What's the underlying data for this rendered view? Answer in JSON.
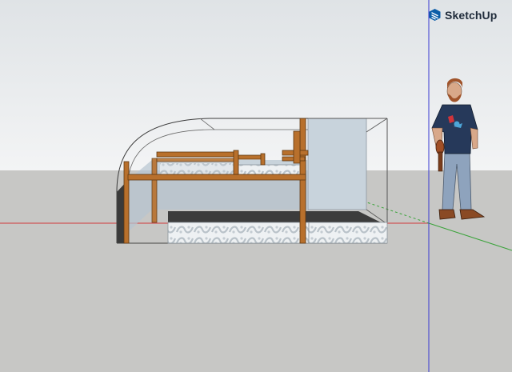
{
  "app": {
    "name": "SketchUp",
    "logo_icon": "sketchup-logo-icon"
  },
  "colors": {
    "sky_top": "#dfe3e6",
    "sky_bottom": "#f3f4f5",
    "ground": "#c7c7c5",
    "axis_red": "#d23a3a",
    "axis_green": "#3aa33a",
    "axis_blue": "#3a3ad2",
    "wood": "#b8702c",
    "mattress": "#eef1f3",
    "window_tint": "#c8d3dc",
    "brand": "#0c5ea8"
  },
  "scene": {
    "model": "camper-bunk-bed",
    "scale_figure": "person-figure"
  }
}
